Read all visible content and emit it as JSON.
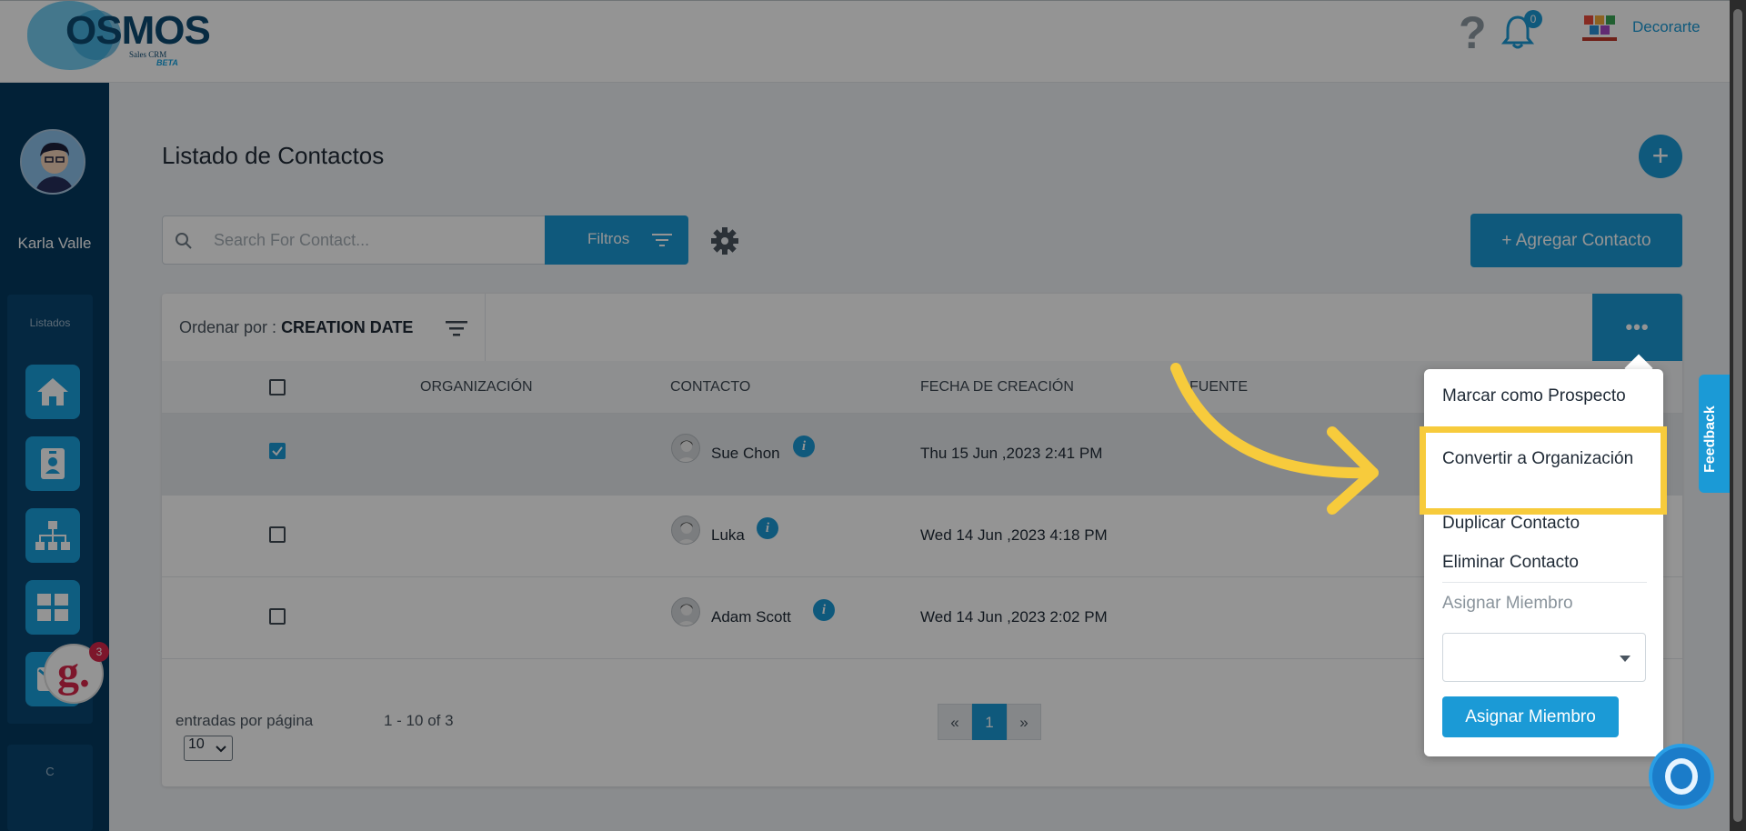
{
  "header": {
    "logo_text": "OSMOS",
    "logo_sub": "Sales CRM",
    "logo_beta": "BETA",
    "help_glyph": "?",
    "notification_count": "0",
    "brand_name": "Decorarte"
  },
  "sidebar": {
    "user_name": "Karla Valle",
    "section_label": "Listados",
    "items": [
      {
        "icon": "home-icon"
      },
      {
        "icon": "contact-card-icon"
      },
      {
        "icon": "org-chart-icon"
      },
      {
        "icon": "dashboard-grid-icon"
      },
      {
        "icon": "mail-icon"
      }
    ],
    "section2_label": "C",
    "g_badge_letter": "g.",
    "g_badge_count": "3"
  },
  "main": {
    "title": "Listado de Contactos",
    "add_fab": "+",
    "search_placeholder": "Search For Contact...",
    "filter_label": "Filtros",
    "add_contact_label": "+ Agregar Contacto",
    "sort_prefix": "Ordenar por : ",
    "sort_value": "CREATION DATE",
    "more_label": "•••",
    "columns": [
      "ORGANIZACIÓN",
      "CONTACTO",
      "FECHA DE CREACIÓN",
      "FUENTE"
    ],
    "rows": [
      {
        "organization": "",
        "contact": "Sue Chon",
        "created": "Thu 15 Jun ,2023 2:41 PM",
        "source": "",
        "checked": true
      },
      {
        "organization": "",
        "contact": "Luka",
        "created": "Wed 14 Jun ,2023 4:18 PM",
        "source": "",
        "checked": false
      },
      {
        "organization": "",
        "contact": "Adam Scott",
        "created": "Wed 14 Jun ,2023 2:02 PM",
        "source": "",
        "checked": false
      }
    ],
    "info_glyph": "i",
    "per_page_label": "entradas por página",
    "per_page_value": "10",
    "range_label": "1 - 10 of 3",
    "pager": {
      "prev": "«",
      "current": "1",
      "next": "»"
    }
  },
  "menu": {
    "items": [
      "Marcar como Prospecto",
      "Convertir a Organización",
      "Duplicar Contacto",
      "Eliminar Contacto"
    ],
    "assign_heading": "Asignar Miembro",
    "assign_button": "Asignar Miembro"
  },
  "feedback_label": "Feedback",
  "colors": {
    "accent": "#1b9ad6",
    "sidebar": "#053a60",
    "highlight": "#f7cb3c",
    "brand_red": "#d8264b"
  }
}
